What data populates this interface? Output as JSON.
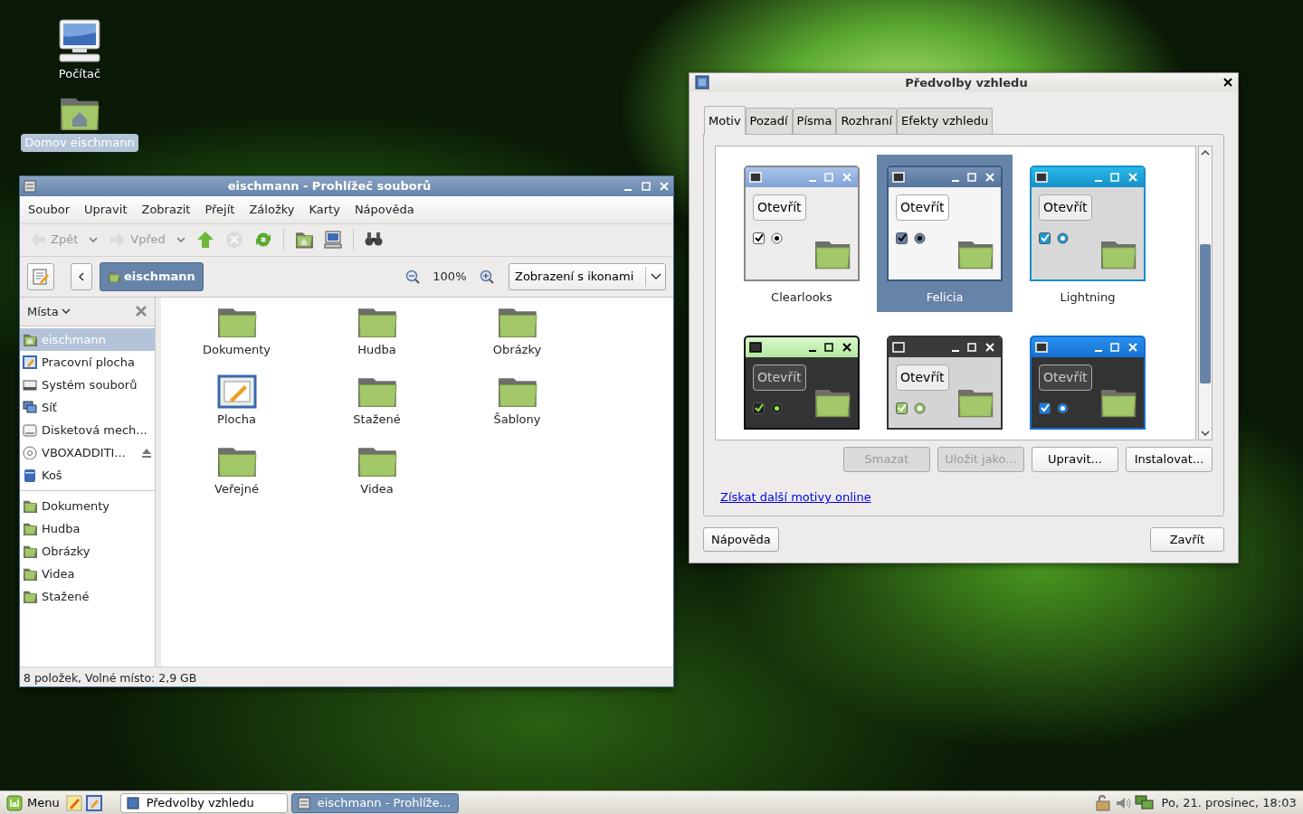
{
  "desktop": {
    "icons": [
      {
        "label": "Počítač",
        "kind": "computer",
        "selected": false
      },
      {
        "label": "Domov eischmann",
        "kind": "home",
        "selected": true
      }
    ]
  },
  "file_manager": {
    "title": "eischmann - Prohlížeč souborů",
    "menu": [
      "Soubor",
      "Upravit",
      "Zobrazit",
      "Přejít",
      "Záložky",
      "Karty",
      "Nápověda"
    ],
    "toolbar": [
      {
        "kind": "back",
        "label": "Zpět",
        "disabled": true
      },
      {
        "kind": "forward",
        "label": "Vpřed",
        "disabled": true
      },
      {
        "kind": "up",
        "disabled": false
      },
      {
        "kind": "stop",
        "disabled": true
      },
      {
        "kind": "reload",
        "disabled": false
      },
      {
        "kind": "home",
        "disabled": false
      },
      {
        "kind": "computer",
        "disabled": false
      },
      {
        "kind": "search",
        "disabled": false
      }
    ],
    "path": [
      {
        "label": "eischmann",
        "selected": true
      }
    ],
    "zoom": "100%",
    "view_mode": "Zobrazení s ikonami",
    "sidebar": {
      "title": "Místa",
      "places": [
        {
          "label": "eischmann",
          "kind": "home",
          "selected": true,
          "eject": false
        },
        {
          "label": "Pracovní plocha",
          "kind": "desktop",
          "selected": false,
          "eject": false
        },
        {
          "label": "Systém souborů",
          "kind": "drive",
          "selected": false,
          "eject": false
        },
        {
          "label": "Síť",
          "kind": "network",
          "selected": false,
          "eject": false
        },
        {
          "label": "Disketová mech...",
          "kind": "floppy",
          "selected": false,
          "eject": false
        },
        {
          "label": "VBOXADDITI...",
          "kind": "cdrom",
          "selected": false,
          "eject": true
        },
        {
          "label": "Koš",
          "kind": "trash",
          "selected": false,
          "eject": false
        }
      ],
      "bookmarks": [
        "Dokumenty",
        "Hudba",
        "Obrázky",
        "Videa",
        "Stažené"
      ]
    },
    "files": [
      {
        "label": "Dokumenty",
        "kind": "folder"
      },
      {
        "label": "Hudba",
        "kind": "folder"
      },
      {
        "label": "Obrázky",
        "kind": "folder"
      },
      {
        "label": "Plocha",
        "kind": "desktop"
      },
      {
        "label": "Stažené",
        "kind": "folder"
      },
      {
        "label": "Šablony",
        "kind": "folder"
      },
      {
        "label": "Veřejné",
        "kind": "folder"
      },
      {
        "label": "Videa",
        "kind": "folder"
      }
    ],
    "status_bar": "8 položek, Volné místo: 2,9 GB"
  },
  "appearance_dialog": {
    "title": "Předvolby vzhledu",
    "tabs": [
      {
        "label": "Motiv",
        "selected": true
      },
      {
        "label": "Pozadí",
        "selected": false
      },
      {
        "label": "Písma",
        "selected": false
      },
      {
        "label": "Rozhraní",
        "selected": false
      },
      {
        "label": "Efekty vzhledu",
        "selected": false
      }
    ],
    "themes": [
      {
        "name": "Clearlooks",
        "kind": "clearlooks",
        "button_label": "Otevřít",
        "selected": false
      },
      {
        "name": "Felicia",
        "kind": "felicia",
        "button_label": "Otevřít",
        "selected": true
      },
      {
        "name": "Lightning",
        "kind": "lightning",
        "button_label": "Otevřít",
        "selected": false
      },
      {
        "kind": "darkgreen",
        "button_label": "Otevřít",
        "selected": false
      },
      {
        "kind": "darkgrey",
        "button_label": "Otevřít",
        "selected": false
      },
      {
        "kind": "darkblue",
        "button_label": "Otevřít",
        "selected": false
      }
    ],
    "actions": [
      {
        "label": "Smazat",
        "disabled": true
      },
      {
        "label": "Uložit jako...",
        "disabled": true
      },
      {
        "label": "Upravit...",
        "disabled": false
      },
      {
        "label": "Instalovat...",
        "disabled": false
      }
    ],
    "link": "Získat další motivy online",
    "footer": [
      "Nápověda",
      "Zavřít"
    ]
  },
  "taskbar": {
    "menu": "Menu",
    "tasks": [
      {
        "label": "Předvolby vzhledu",
        "kind": "dialog",
        "selected": false
      },
      {
        "label": "eischmann - Prohlíže...",
        "kind": "files",
        "selected": true
      }
    ],
    "clock": "Po, 21. prosinec, 18:03"
  }
}
